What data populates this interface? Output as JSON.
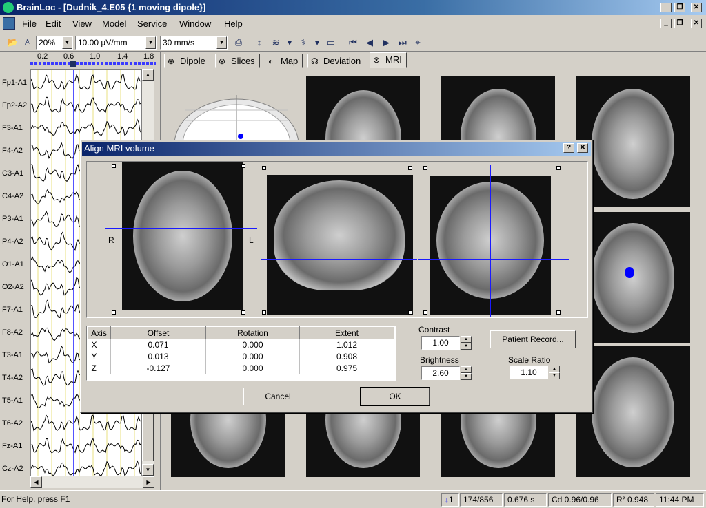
{
  "window": {
    "title": "BrainLoc - [Dudnik_4.E05 {1 moving dipole}]"
  },
  "menu": [
    "File",
    "Edit",
    "View",
    "Model",
    "Service",
    "Window",
    "Help"
  ],
  "toolbar": {
    "zoom": "20%",
    "sensitivity": "10.00 µV/mm",
    "speed": "30 mm/s"
  },
  "ruler": [
    "0.2",
    "0.6",
    "1.0",
    "1.4",
    "1.8"
  ],
  "channels": [
    "Fp1-A1",
    "Fp2-A2",
    "F3-A1",
    "F4-A2",
    "C3-A1",
    "C4-A2",
    "P3-A1",
    "P4-A2",
    "O1-A1",
    "O2-A2",
    "F7-A1",
    "F8-A2",
    "T3-A1",
    "T4-A2",
    "T5-A1",
    "T6-A2",
    "Fz-A1",
    "Cz-A2"
  ],
  "tabs": [
    "Dipole",
    "Slices",
    "Map",
    "Deviation",
    "MRI"
  ],
  "dialog": {
    "title": "Align MRI volume",
    "help": "?",
    "close": "✕",
    "side_right": "R",
    "side_left": "L",
    "table": {
      "headers": [
        "Axis",
        "Offset",
        "Rotation",
        "Extent"
      ],
      "rows": [
        [
          "X",
          "0.071",
          "0.000",
          "1.012"
        ],
        [
          "Y",
          "0.013",
          "0.000",
          "0.908"
        ],
        [
          "Z",
          "-0.127",
          "0.000",
          "0.975"
        ]
      ]
    },
    "contrast": {
      "label": "Contrast",
      "value": "1.00"
    },
    "brightness": {
      "label": "Brightness",
      "value": "2.60"
    },
    "scale_ratio": {
      "label": "Scale Ratio",
      "value": "1.10"
    },
    "patient_record": "Patient Record...",
    "cancel": "Cancel",
    "ok": "OK"
  },
  "status": {
    "help": "For Help, press F1",
    "marker": "1",
    "position": "174/856",
    "time": "0.676 s",
    "cd": "Cd 0.96/0.96",
    "r2": "R² 0.948",
    "clock": "11:44 PM"
  },
  "colors": {
    "title_start": "#0a246a",
    "title_end": "#a6caf0",
    "cursor": "#1a1aff",
    "dipole": "#0000ff"
  }
}
